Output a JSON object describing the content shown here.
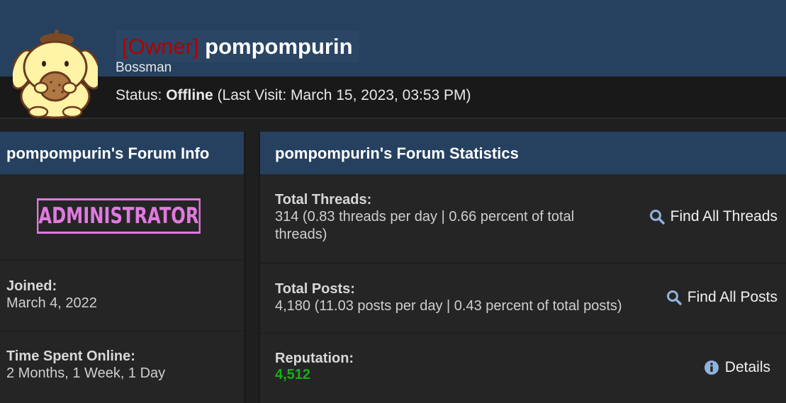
{
  "profile": {
    "rank": "[Owner]",
    "username": "pompompurin",
    "usertitle": "Bossman",
    "status_label": "Status:",
    "status_value": "Offline",
    "last_visit": "(Last Visit: March 15, 2023, 03:53 PM)"
  },
  "forum_info": {
    "title": "pompompurin's Forum Info",
    "badge": "ADMINISTRATOR",
    "joined_label": "Joined:",
    "joined_value": "March 4, 2022",
    "online_label": "Time Spent Online:",
    "online_value": "2 Months, 1 Week, 1 Day"
  },
  "forum_stats": {
    "title": "pompompurin's Forum Statistics",
    "threads_label": "Total Threads:",
    "threads_value": "314 (0.83 threads per day | 0.66 percent of total threads)",
    "threads_action": "Find All Threads",
    "posts_label": "Total Posts:",
    "posts_value": "4,180 (11.03 posts per day | 0.43 percent of total posts)",
    "posts_action": "Find All Posts",
    "reputation_label": "Reputation:",
    "reputation_value": "4,512",
    "reputation_action": "Details"
  },
  "colors": {
    "header": "#25415f",
    "owner_rank": "#b20000",
    "badge": "#e07adf",
    "reputation": "#14b014",
    "icon": "#8fb3d9"
  },
  "icons": [
    "avatar-icon",
    "search-icon",
    "info-icon"
  ]
}
